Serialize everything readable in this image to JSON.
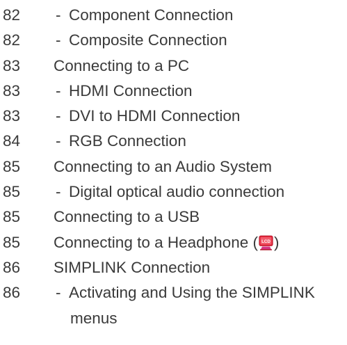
{
  "toc": [
    {
      "page": "82",
      "dash": "-",
      "title": "Component Connection"
    },
    {
      "page": "82",
      "dash": "-",
      "title": "Composite Connection"
    },
    {
      "page": "83",
      "dash": "",
      "title": "Connecting to a PC"
    },
    {
      "page": "83",
      "dash": "-",
      "title": "HDMI Connection"
    },
    {
      "page": "83",
      "dash": "-",
      "title": "DVI to HDMI Connection"
    },
    {
      "page": "84",
      "dash": "-",
      "title": "RGB Connection"
    },
    {
      "page": "85",
      "dash": "",
      "title": "Connecting to an Audio System"
    },
    {
      "page": "85",
      "dash": "-",
      "title": "Digital optical audio connection"
    },
    {
      "page": "85",
      "dash": "",
      "title": "Connecting to a USB"
    },
    {
      "page": "85",
      "dash": "",
      "title_before": "Connecting to a Headphone (",
      "title_after": ")",
      "icon": "lcd-tv-icon",
      "icon_label": "LCD"
    },
    {
      "page": "86",
      "dash": "",
      "title": "SIMPLINK Connection"
    },
    {
      "page": "86",
      "dash": "-",
      "title_line1": "Activating and Using the SIMPLINK",
      "title_line2": "menus"
    }
  ],
  "colors": {
    "text": "#3a3a3a",
    "icon_red": "#e0263a",
    "icon_magenta": "#d63384"
  }
}
